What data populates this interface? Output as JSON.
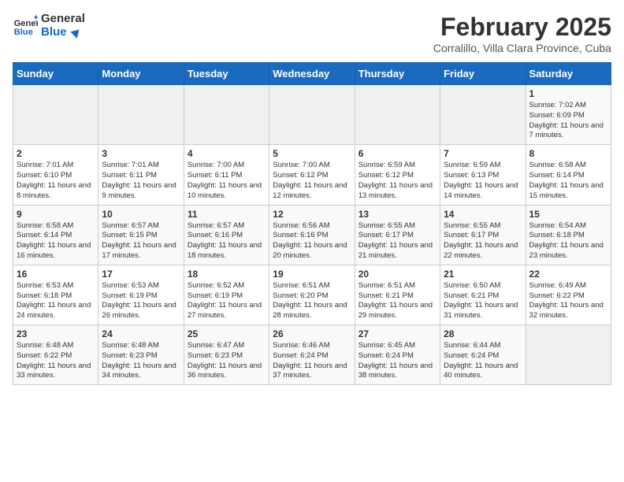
{
  "header": {
    "logo_line1": "General",
    "logo_line2": "Blue",
    "title": "February 2025",
    "subtitle": "Corralillo, Villa Clara Province, Cuba"
  },
  "weekdays": [
    "Sunday",
    "Monday",
    "Tuesday",
    "Wednesday",
    "Thursday",
    "Friday",
    "Saturday"
  ],
  "weeks": [
    [
      {
        "day": "",
        "info": ""
      },
      {
        "day": "",
        "info": ""
      },
      {
        "day": "",
        "info": ""
      },
      {
        "day": "",
        "info": ""
      },
      {
        "day": "",
        "info": ""
      },
      {
        "day": "",
        "info": ""
      },
      {
        "day": "1",
        "info": "Sunrise: 7:02 AM\nSunset: 6:09 PM\nDaylight: 11 hours and 7 minutes."
      }
    ],
    [
      {
        "day": "2",
        "info": "Sunrise: 7:01 AM\nSunset: 6:10 PM\nDaylight: 11 hours and 8 minutes."
      },
      {
        "day": "3",
        "info": "Sunrise: 7:01 AM\nSunset: 6:11 PM\nDaylight: 11 hours and 9 minutes."
      },
      {
        "day": "4",
        "info": "Sunrise: 7:00 AM\nSunset: 6:11 PM\nDaylight: 11 hours and 10 minutes."
      },
      {
        "day": "5",
        "info": "Sunrise: 7:00 AM\nSunset: 6:12 PM\nDaylight: 11 hours and 12 minutes."
      },
      {
        "day": "6",
        "info": "Sunrise: 6:59 AM\nSunset: 6:12 PM\nDaylight: 11 hours and 13 minutes."
      },
      {
        "day": "7",
        "info": "Sunrise: 6:59 AM\nSunset: 6:13 PM\nDaylight: 11 hours and 14 minutes."
      },
      {
        "day": "8",
        "info": "Sunrise: 6:58 AM\nSunset: 6:14 PM\nDaylight: 11 hours and 15 minutes."
      }
    ],
    [
      {
        "day": "9",
        "info": "Sunrise: 6:58 AM\nSunset: 6:14 PM\nDaylight: 11 hours and 16 minutes."
      },
      {
        "day": "10",
        "info": "Sunrise: 6:57 AM\nSunset: 6:15 PM\nDaylight: 11 hours and 17 minutes."
      },
      {
        "day": "11",
        "info": "Sunrise: 6:57 AM\nSunset: 6:16 PM\nDaylight: 11 hours and 18 minutes."
      },
      {
        "day": "12",
        "info": "Sunrise: 6:56 AM\nSunset: 6:16 PM\nDaylight: 11 hours and 20 minutes."
      },
      {
        "day": "13",
        "info": "Sunrise: 6:55 AM\nSunset: 6:17 PM\nDaylight: 11 hours and 21 minutes."
      },
      {
        "day": "14",
        "info": "Sunrise: 6:55 AM\nSunset: 6:17 PM\nDaylight: 11 hours and 22 minutes."
      },
      {
        "day": "15",
        "info": "Sunrise: 6:54 AM\nSunset: 6:18 PM\nDaylight: 11 hours and 23 minutes."
      }
    ],
    [
      {
        "day": "16",
        "info": "Sunrise: 6:53 AM\nSunset: 6:18 PM\nDaylight: 11 hours and 24 minutes."
      },
      {
        "day": "17",
        "info": "Sunrise: 6:53 AM\nSunset: 6:19 PM\nDaylight: 11 hours and 26 minutes."
      },
      {
        "day": "18",
        "info": "Sunrise: 6:52 AM\nSunset: 6:19 PM\nDaylight: 11 hours and 27 minutes."
      },
      {
        "day": "19",
        "info": "Sunrise: 6:51 AM\nSunset: 6:20 PM\nDaylight: 11 hours and 28 minutes."
      },
      {
        "day": "20",
        "info": "Sunrise: 6:51 AM\nSunset: 6:21 PM\nDaylight: 11 hours and 29 minutes."
      },
      {
        "day": "21",
        "info": "Sunrise: 6:50 AM\nSunset: 6:21 PM\nDaylight: 11 hours and 31 minutes."
      },
      {
        "day": "22",
        "info": "Sunrise: 6:49 AM\nSunset: 6:22 PM\nDaylight: 11 hours and 32 minutes."
      }
    ],
    [
      {
        "day": "23",
        "info": "Sunrise: 6:48 AM\nSunset: 6:22 PM\nDaylight: 11 hours and 33 minutes."
      },
      {
        "day": "24",
        "info": "Sunrise: 6:48 AM\nSunset: 6:23 PM\nDaylight: 11 hours and 34 minutes."
      },
      {
        "day": "25",
        "info": "Sunrise: 6:47 AM\nSunset: 6:23 PM\nDaylight: 11 hours and 36 minutes."
      },
      {
        "day": "26",
        "info": "Sunrise: 6:46 AM\nSunset: 6:24 PM\nDaylight: 11 hours and 37 minutes."
      },
      {
        "day": "27",
        "info": "Sunrise: 6:45 AM\nSunset: 6:24 PM\nDaylight: 11 hours and 38 minutes."
      },
      {
        "day": "28",
        "info": "Sunrise: 6:44 AM\nSunset: 6:24 PM\nDaylight: 11 hours and 40 minutes."
      },
      {
        "day": "",
        "info": ""
      }
    ]
  ]
}
